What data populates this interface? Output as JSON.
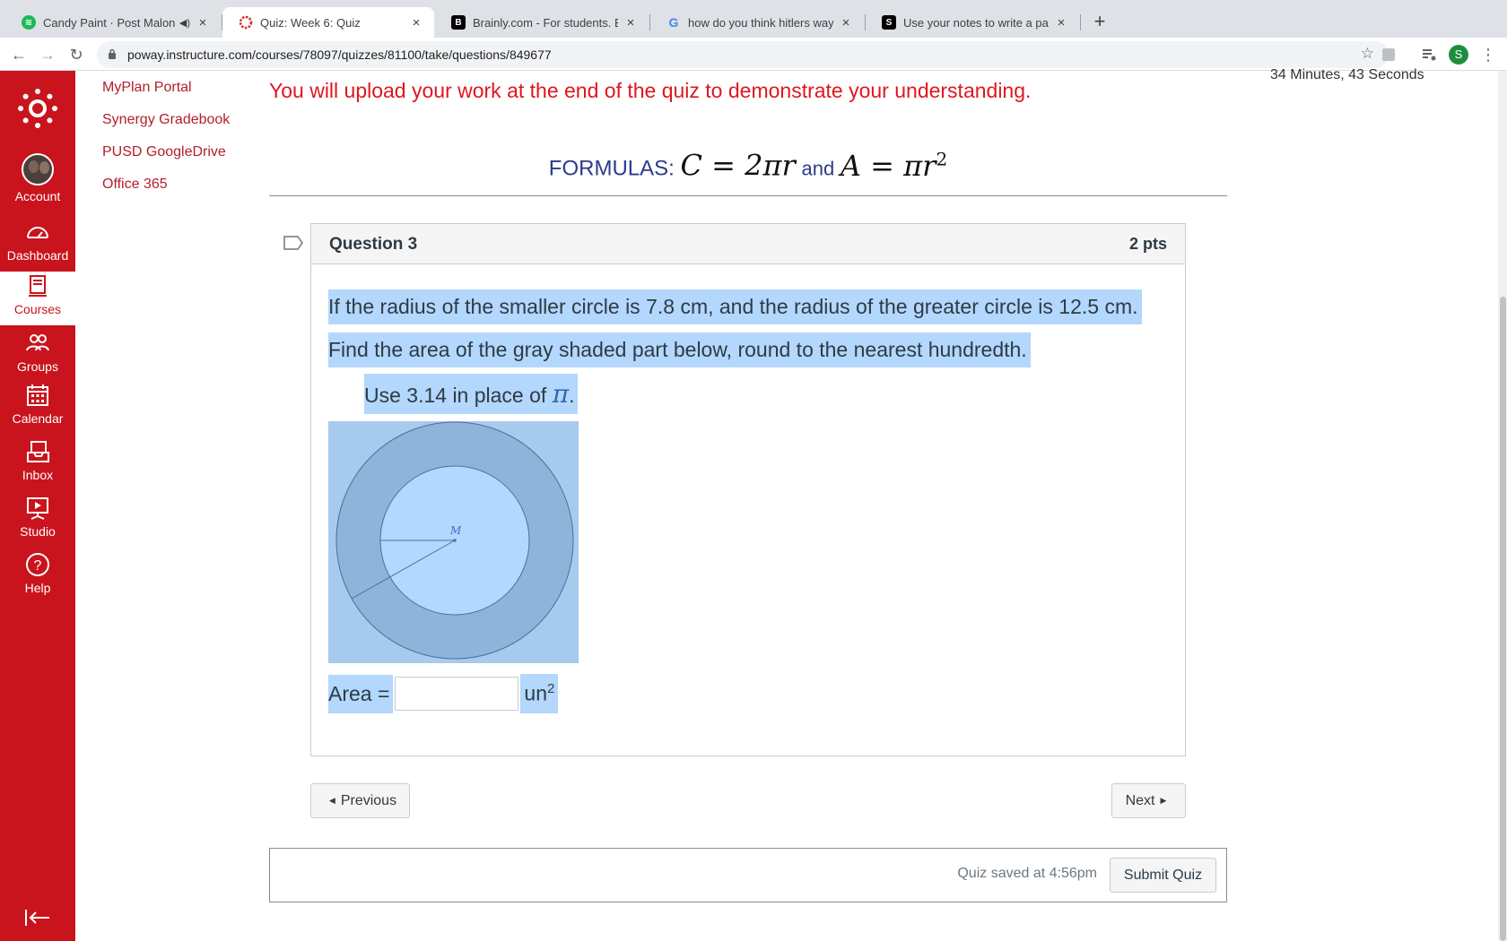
{
  "browser": {
    "tabs": [
      {
        "title": "Candy Paint · Post Malone",
        "favicon": "spotify-icon"
      },
      {
        "title": "Quiz: Week 6: Quiz",
        "favicon": "canvas-icon"
      },
      {
        "title": "Brainly.com - For students. By",
        "favicon": "brainly-icon"
      },
      {
        "title": "how do you think hitlers way of",
        "favicon": "google-icon"
      },
      {
        "title": "Use your notes to write a parag",
        "favicon": "studyx-icon"
      }
    ],
    "url": "poway.instructure.com/courses/78097/quizzes/81100/take/questions/849677",
    "profile_initial": "S",
    "colors": {
      "tabbar": "#dee1e6",
      "profile": "#1e8e3e"
    }
  },
  "global_nav": {
    "color": "#c9141d",
    "items": [
      {
        "label": "Account",
        "icon": "avatar"
      },
      {
        "label": "Dashboard",
        "icon": "dashboard-icon"
      },
      {
        "label": "Courses",
        "icon": "courses-icon"
      },
      {
        "label": "Groups",
        "icon": "groups-icon"
      },
      {
        "label": "Calendar",
        "icon": "calendar-icon"
      },
      {
        "label": "Inbox",
        "icon": "inbox-icon"
      },
      {
        "label": "Studio",
        "icon": "studio-icon"
      },
      {
        "label": "Help",
        "icon": "help-icon"
      }
    ]
  },
  "course_nav": {
    "links": [
      "MyPlan Portal",
      "Synergy Gradebook",
      "PUSD GoogleDrive",
      "Office 365"
    ]
  },
  "timer": "34 Minutes, 43 Seconds",
  "upload_note": "You will upload your work at the end of the quiz to demonstrate your understanding.",
  "formulas": {
    "label": "FORMULAS:",
    "circumference": "C = 2πr",
    "joiner": "and",
    "area": "A = πr",
    "area_exp": "2"
  },
  "question": {
    "name": "Question 3",
    "points": "2 pts",
    "line1": "If the radius of the smaller circle is 7.8 cm, and the radius of the greater circle is 12.5 cm.",
    "line2": "Find the area of the gray shaded part below, round to the nearest hundredth.",
    "line3": "Use 3.14 in place of",
    "pi": "π",
    "line3_end": ".",
    "figure_center_label": "M",
    "answer_label": "Area =",
    "answer_value": "",
    "answer_unit": "un",
    "answer_unit_exp": "2"
  },
  "navigation": {
    "previous": "Previous",
    "next": "Next"
  },
  "footer": {
    "saved": "Quiz saved at 4:56pm",
    "submit": "Submit Quiz"
  }
}
